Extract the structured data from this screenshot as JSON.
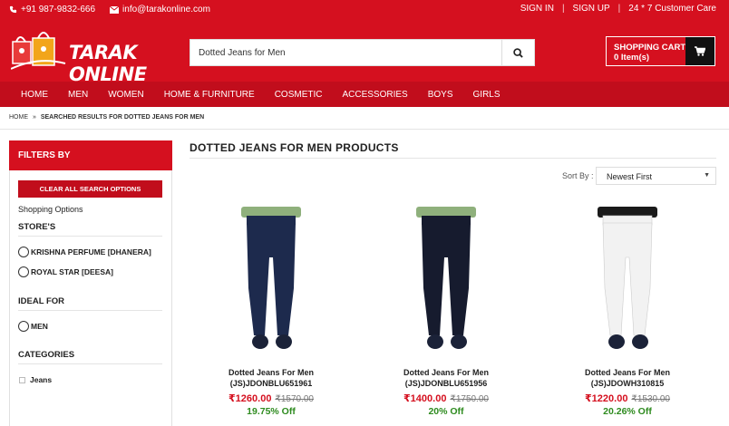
{
  "topbar": {
    "phone": "+91 987-9832-666",
    "email": "info@tarakonline.com",
    "sign_in": "SIGN IN",
    "sign_up": "SIGN UP",
    "customer_care": "24 * 7 Customer Care",
    "separator": "|"
  },
  "header": {
    "logo_text": "TARAK ONLINE",
    "search_value": "Dotted Jeans for Men",
    "cart_title": "SHOPPING CART",
    "cart_items": "0 Item(s)"
  },
  "nav": {
    "items": [
      "HOME",
      "MEN",
      "WOMEN",
      "HOME & FURNITURE",
      "COSMETIC",
      "ACCESSORIES",
      "BOYS",
      "GIRLS"
    ]
  },
  "breadcrumb": {
    "home": "HOME",
    "separator": "»",
    "current": "SEARCHED RESULTS FOR DOTTED JEANS FOR MEN"
  },
  "sidebar": {
    "title": "FILTERS BY",
    "clear_label": "CLEAR ALL SEARCH OPTIONS",
    "shopping_options": "Shopping Options",
    "stores_head": "STORE'S",
    "stores": [
      "KRISHNA PERFUME [DHANERA]",
      "ROYAL STAR [DEESA]"
    ],
    "ideal_head": "IDEAL FOR",
    "ideal": [
      "MEN"
    ],
    "categories_head": "CATEGORIES",
    "categories": [
      "Jeans"
    ]
  },
  "main": {
    "title": "DOTTED JEANS FOR MEN PRODUCTS",
    "sort_label": "Sort By :",
    "sort_value": "Newest First"
  },
  "products": [
    {
      "name": "Dotted Jeans For Men",
      "code": "(JS)JDONBLU651961",
      "price": "₹1260.00",
      "old_price": "₹1570.00",
      "off": "19.75% Off",
      "jeans_color": "#1d2a4d",
      "shirt_color": "#8fb07c"
    },
    {
      "name": "Dotted Jeans For Men",
      "code": "(JS)JDONBLU651956",
      "price": "₹1400.00",
      "old_price": "₹1750.00",
      "off": "20% Off",
      "jeans_color": "#161b2e",
      "shirt_color": "#8fb07c"
    },
    {
      "name": "Dotted Jeans For Men",
      "code": "(JS)JDOWH310815",
      "price": "₹1220.00",
      "old_price": "₹1530.00",
      "off": "20.26% Off",
      "jeans_color": "#f2f2f2",
      "shirt_color": "#1a1a1a"
    }
  ],
  "colors": {
    "brand_red": "#d5101f",
    "nav_red": "#c10d1c",
    "discount_green": "#2e8b1f"
  }
}
